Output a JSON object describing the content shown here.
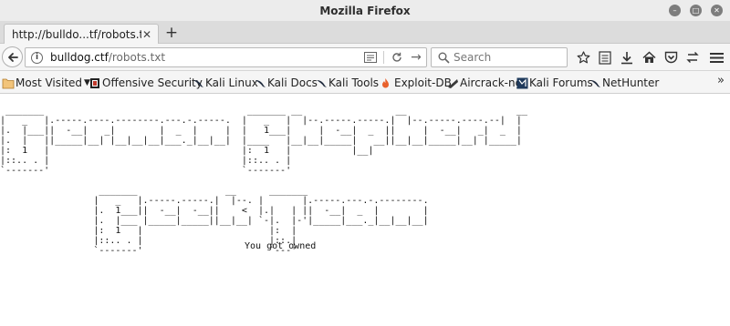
{
  "window": {
    "title": "Mozilla Firefox"
  },
  "tabs": [
    {
      "label": "http://bulldo...tf/robots.txt"
    }
  ],
  "navbar": {
    "url_host": "bulldog.ctf",
    "url_path": "/robots.txt",
    "search_placeholder": "Search"
  },
  "bookmarks": [
    {
      "label": "Most Visited",
      "icon": "folder-icon"
    },
    {
      "label": "Offensive Security",
      "icon": "offsec-icon"
    },
    {
      "label": "Kali Linux",
      "icon": "kali-dragon-icon"
    },
    {
      "label": "Kali Docs",
      "icon": "kali-dragon-icon"
    },
    {
      "label": "Kali Tools",
      "icon": "kali-dragon-icon"
    },
    {
      "label": "Exploit-DB",
      "icon": "exploitdb-icon"
    },
    {
      "label": "Aircrack-ng",
      "icon": "aircrack-icon"
    },
    {
      "label": "Kali Forums",
      "icon": "kali-forums-icon"
    },
    {
      "label": "NetHunter",
      "icon": "kali-dragon-icon"
    }
  ],
  "content": {
    "ascii_art": " _______                                     _______ __                 __                    __ \n|   _   |.-----.----.--------.---.-.-----.  |   _   |  |--.-----.-----.|  |--.-----.----.--|  |\n|.  |___||  -__|   _|        |  _  |     |  |   1___|     |  -__|  _  ||     |  -__|   _|  _  |\n|.  |   ||_____|__| |__|__|__|___._|__|__|  |____   |__|__|_____|   __||__|__|_____|__| |_____|\n|:  1   |                                   |:  1   |           |__|                            \n|::.. . |                                   |::.. . |                                          \n`-------'                                   `-------'                                          \n\n                  _______                __      _______                                        \n                 |   _   |.-----.-----.|  |--. |       |.-----.---.-.--------.                 \n                 |.  1___||  -__|  -__||    <  |.|   | ||  -__|  _  |        |                 \n                 |.  |___ |_____|_____||__|__| `-|.  |-'|_____|___._|__|__|__|                 \n                 |:  1   |                       |:  |                                          \n                 |::.. . |                       |::.|                                          \n                 `-------'                       `---'                                          \n",
    "message": "You got owned"
  }
}
